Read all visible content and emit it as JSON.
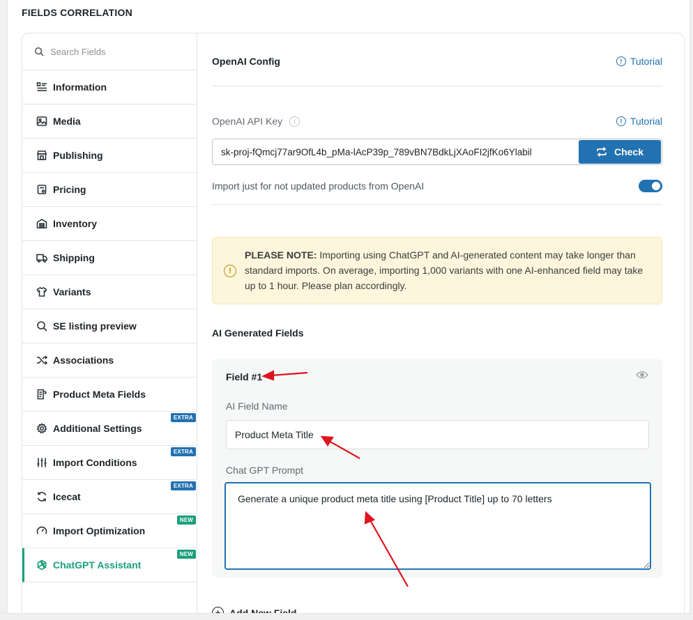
{
  "section_title": "FIELDS CORRELATION",
  "search": {
    "placeholder": "Search Fields"
  },
  "sidebar": {
    "items": [
      {
        "label": "Information",
        "icon": "list-icon"
      },
      {
        "label": "Media",
        "icon": "image-icon"
      },
      {
        "label": "Publishing",
        "icon": "store-icon"
      },
      {
        "label": "Pricing",
        "icon": "price-tag-icon"
      },
      {
        "label": "Inventory",
        "icon": "warehouse-icon"
      },
      {
        "label": "Shipping",
        "icon": "truck-icon"
      },
      {
        "label": "Variants",
        "icon": "shirt-icon"
      },
      {
        "label": "SE listing preview",
        "icon": "search-icon"
      },
      {
        "label": "Associations",
        "icon": "shuffle-icon"
      },
      {
        "label": "Product Meta Fields",
        "icon": "meta-doc-icon"
      },
      {
        "label": "Additional Settings",
        "icon": "gear-icon",
        "badge": "EXTRA"
      },
      {
        "label": "Import Conditions",
        "icon": "sliders-icon",
        "badge": "EXTRA"
      },
      {
        "label": "Icecat",
        "icon": "refresh-icon",
        "badge": "EXTRA"
      },
      {
        "label": "Import Optimization",
        "icon": "gauge-icon",
        "badge": "NEW"
      },
      {
        "label": "ChatGPT Assistant",
        "icon": "openai-icon",
        "badge": "NEW",
        "active": true
      }
    ]
  },
  "main": {
    "config_title": "OpenAI Config",
    "tutorial_label": "Tutorial",
    "api_key_label": "OpenAI API Key",
    "api_key_value": "sk-proj-fQmcj77ar9OfL4b_pMa-lAcP39p_789vBN7BdkLjXAoFI2jfKo6Ylabil",
    "check_label": "Check",
    "toggle_label": "Import just for not updated products from OpenAI",
    "toggle_on": true,
    "note_bold": "PLEASE NOTE:",
    "note_text": " Importing using ChatGPT and AI-generated content may take longer than standard imports. On average, importing 1,000 variants with one AI-enhanced field may take up to 1 hour. Please plan accordingly.",
    "ai_fields_title": "AI Generated Fields",
    "field": {
      "title": "Field #1",
      "name_label": "AI Field Name",
      "name_value": "Product Meta Title",
      "prompt_label": "Chat GPT Prompt",
      "prompt_value": "Generate a unique product meta title using [Product Title] up to 70 letters"
    },
    "add_field_label": "Add New Field"
  },
  "colors": {
    "accent_blue": "#2271b1",
    "accent_green": "#1aa07a",
    "note_bg": "#fdf6dd",
    "annotation_red": "#e0141e"
  }
}
